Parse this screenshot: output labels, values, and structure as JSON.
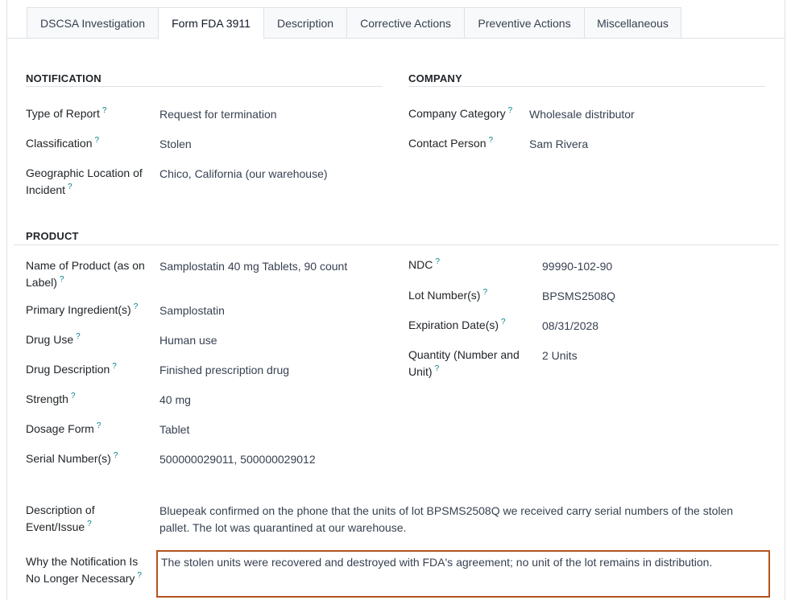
{
  "tabs": [
    {
      "label": "DSCSA Investigation"
    },
    {
      "label": "Form FDA 3911"
    },
    {
      "label": "Description"
    },
    {
      "label": "Corrective Actions"
    },
    {
      "label": "Preventive Actions"
    },
    {
      "label": "Miscellaneous"
    }
  ],
  "active_tab": "Form FDA 3911",
  "notification": {
    "title": "NOTIFICATION",
    "type_of_report": {
      "label": "Type of Report",
      "value": "Request for termination"
    },
    "classification": {
      "label": "Classification",
      "value": "Stolen"
    },
    "geographic_location": {
      "label_line1": "Geographic Location of",
      "label_line2": "Incident",
      "value": "Chico, California (our warehouse)"
    }
  },
  "company": {
    "title": "COMPANY",
    "category": {
      "label": "Company Category",
      "value": "Wholesale distributor"
    },
    "contact": {
      "label": "Contact Person",
      "value": "Sam Rivera"
    }
  },
  "product": {
    "title": "PRODUCT",
    "name": {
      "label_line1": "Name of Product (as on",
      "label_line2": "Label)",
      "value": "Samplostatin 40 mg Tablets, 90 count"
    },
    "primary_ingredient": {
      "label": "Primary Ingredient(s)",
      "value": "Samplostatin"
    },
    "drug_use": {
      "label": "Drug Use",
      "value": "Human use"
    },
    "drug_description": {
      "label": "Drug Description",
      "value": "Finished prescription drug"
    },
    "strength": {
      "label": "Strength",
      "value": "40 mg"
    },
    "dosage_form": {
      "label": "Dosage Form",
      "value": "Tablet"
    },
    "serial_numbers": {
      "label": "Serial Number(s)",
      "value": "500000029011, 500000029012"
    },
    "ndc": {
      "label": "NDC",
      "value": "99990-102-90"
    },
    "lot_numbers": {
      "label": "Lot Number(s)",
      "value": "BPSMS2508Q"
    },
    "expiration": {
      "label": "Expiration Date(s)",
      "value": "08/31/2028"
    },
    "quantity": {
      "label_line1": "Quantity (Number and",
      "label_line2": "Unit)",
      "value": "2 Units"
    }
  },
  "description_event": {
    "label_line1": "Description of",
    "label_line2": "Event/Issue",
    "value_line1": "Bluepeak confirmed on the phone that the units of lot BPSMS2508Q we received carry serial numbers of the stolen",
    "value_line2": "pallet. The lot was quarantined at our warehouse."
  },
  "why_not_necessary": {
    "label_line1": "Why the Notification Is",
    "label_line2": "No Longer Necessary",
    "value": "The stolen units were recovered and destroyed with FDA's agreement; no unit of the lot remains in distribution."
  },
  "help_marker": "?",
  "colors": {
    "accent_focus": "#b3541e",
    "help": "#017e84",
    "border": "#dee2e6"
  }
}
